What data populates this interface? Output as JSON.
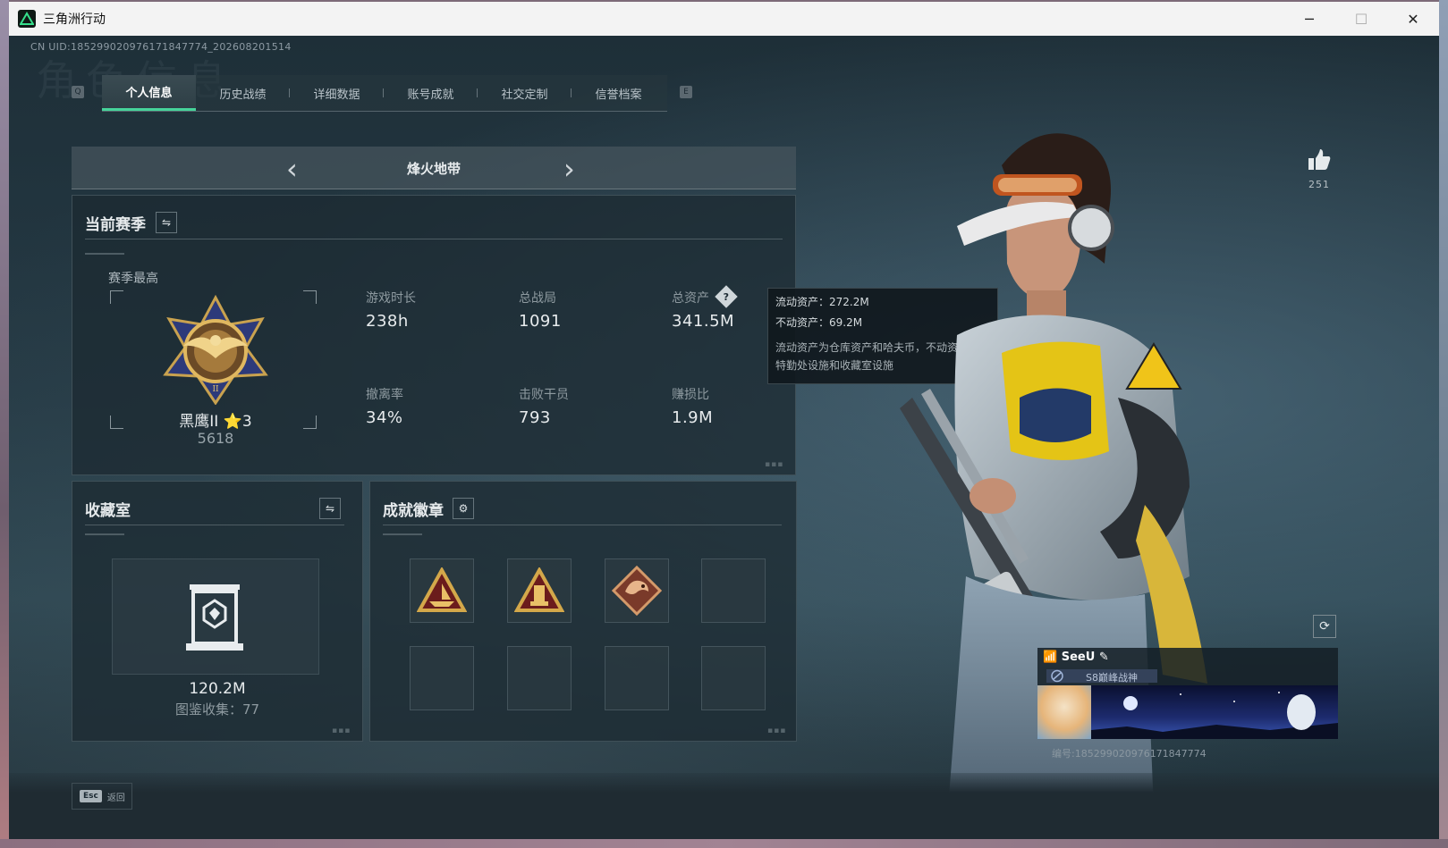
{
  "window": {
    "title": "三角洲行动"
  },
  "uid": "CN UID:1852990209761718477​74_202608201514",
  "background_title": "角色信息",
  "tabs": {
    "left_key": "Q",
    "right_key": "E",
    "items": [
      {
        "label": "个人信息",
        "active": true
      },
      {
        "label": "历史战绩",
        "active": false
      },
      {
        "label": "详细数据",
        "active": false
      },
      {
        "label": "账号成就",
        "active": false
      },
      {
        "label": "社交定制",
        "active": false
      },
      {
        "label": "信誉档案",
        "active": false
      }
    ]
  },
  "mode": {
    "title": "烽火地带",
    "prev": "‹",
    "next": "›"
  },
  "season": {
    "title": "当前赛季",
    "best_label": "赛季最高",
    "rank_name": "黑鹰II ⭐3",
    "rank_score": "5618",
    "stats": {
      "play_time": {
        "label": "游戏时长",
        "value": "238h"
      },
      "total_matches": {
        "label": "总战局",
        "value": "1091"
      },
      "total_assets": {
        "label": "总资产",
        "value": "341.5M"
      },
      "extract_rate": {
        "label": "撤离率",
        "value": "34%"
      },
      "kills": {
        "label": "击败干员",
        "value": "793"
      },
      "profit_ratio": {
        "label": "赚损比",
        "value": "1.9M"
      }
    }
  },
  "tooltip": {
    "liquid": "流动资产：272.2M",
    "fixed": "不动资产：69.2M",
    "desc1": "流动资产为仓库资产和哈夫币，不动资产为",
    "desc2": "特勤处设施和收藏室设施"
  },
  "collection": {
    "title": "收藏室",
    "value": "120.2M",
    "count": "图鉴收集：77"
  },
  "achievements": {
    "title": "成就徽章",
    "badges": [
      {
        "icon": "ship-triangle-badge",
        "color": "#c79a3b"
      },
      {
        "icon": "tower-triangle-badge",
        "color": "#c79a3b"
      },
      {
        "icon": "dragon-diamond-badge",
        "color": "#b96a4a"
      }
    ]
  },
  "likes": {
    "count": "251"
  },
  "profile": {
    "name": "SeeU",
    "title": "S8巅峰战神",
    "id": "编号:18529902097617184​7774"
  },
  "bottom": {
    "esc_key": "Esc",
    "esc_label": "返回"
  },
  "colors": {
    "accent": "#46d49a",
    "panel": "#1c2a33"
  }
}
